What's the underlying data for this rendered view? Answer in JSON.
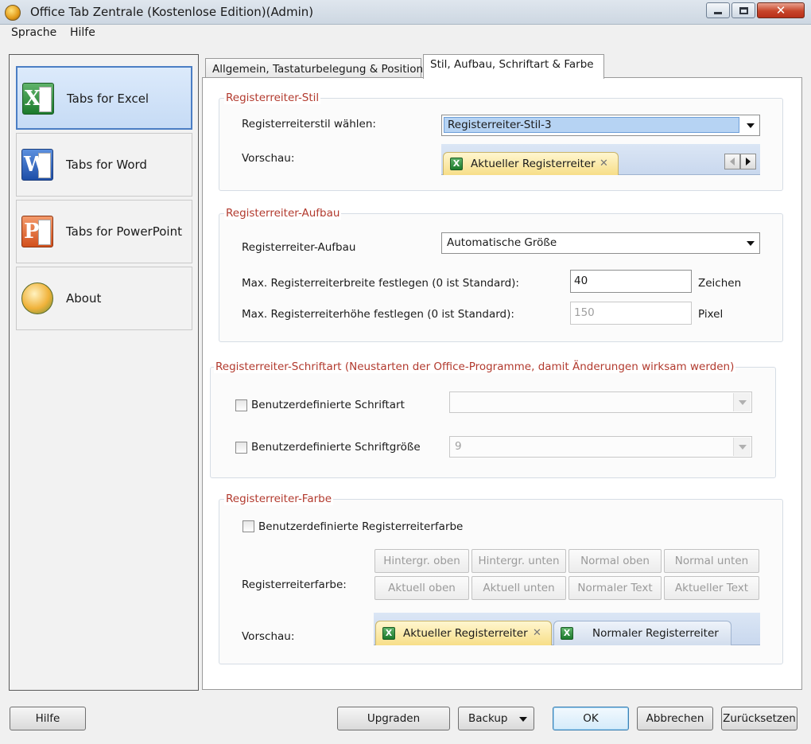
{
  "window": {
    "title": "Office Tab Zentrale (Kostenlose Edition)(Admin)",
    "close_glyph": "✕"
  },
  "menu": {
    "items": [
      "Sprache",
      "Hilfe"
    ]
  },
  "sidebar": {
    "items": [
      {
        "label": "Tabs for Excel",
        "icon": "excel-icon",
        "letter": "X",
        "active": true
      },
      {
        "label": "Tabs for Word",
        "icon": "word-icon",
        "letter": "W",
        "active": false
      },
      {
        "label": "Tabs for PowerPoint",
        "icon": "powerpoint-icon",
        "letter": "P",
        "active": false
      },
      {
        "label": "About",
        "icon": "about-icon",
        "active": false
      }
    ]
  },
  "tabs": [
    {
      "label": "Allgemein, Tastaturbelegung & Position",
      "active": false
    },
    {
      "label": "Stil, Aufbau, Schriftart & Farbe",
      "active": true
    }
  ],
  "stil": {
    "title": "Registerreiter-Stil",
    "style_label": "Registerreiterstil wählen:",
    "style_value": "Registerreiter-Stil-3",
    "preview_label": "Vorschau:",
    "preview_tab": "Aktueller Registerreiter",
    "close_glyph": "✕"
  },
  "aufbau": {
    "title": "Registerreiter-Aufbau",
    "layout_label": "Registerreiter-Aufbau",
    "layout_value": "Automatische Größe",
    "max_width_label": "Max. Registerreiterbreite festlegen (0 ist Standard):",
    "max_width_value": "40",
    "max_width_unit": "Zeichen",
    "max_height_label": "Max. Registerreiterhöhe festlegen (0 ist Standard):",
    "max_height_value": "150",
    "max_height_unit": "Pixel"
  },
  "schrift": {
    "title": "Registerreiter-Schriftart (Neustarten der Office-Programme, damit Änderungen wirksam werden)",
    "custom_font_label": "Benutzerdefinierte Schriftart",
    "custom_font_value": "",
    "custom_size_label": "Benutzerdefinierte Schriftgröße",
    "custom_size_value": "9"
  },
  "farbe": {
    "title": "Registerreiter-Farbe",
    "custom_color_label": "Benutzerdefinierte Registerreiterfarbe",
    "color_label": "Registerreiterfarbe:",
    "buttons_row1": [
      "Hintergr. oben",
      "Hintergr. unten",
      "Normal oben",
      "Normal unten"
    ],
    "buttons_row2": [
      "Aktuell oben",
      "Aktuell unten",
      "Normaler Text",
      "Aktueller Text"
    ],
    "preview_label": "Vorschau:",
    "preview_active_tab": "Aktueller Registerreiter",
    "preview_normal_tab": "Normaler Registerreiter",
    "close_glyph": "✕"
  },
  "footer": {
    "help": "Hilfe",
    "upgrade": "Upgraden",
    "backup": "Backup",
    "ok": "OK",
    "cancel": "Abbrechen",
    "reset": "Zurücksetzen"
  },
  "colors": {
    "group_title": "#b23a2e",
    "active_nav_border": "#4b7ec4",
    "active_tab_fill": "#f7de88"
  }
}
